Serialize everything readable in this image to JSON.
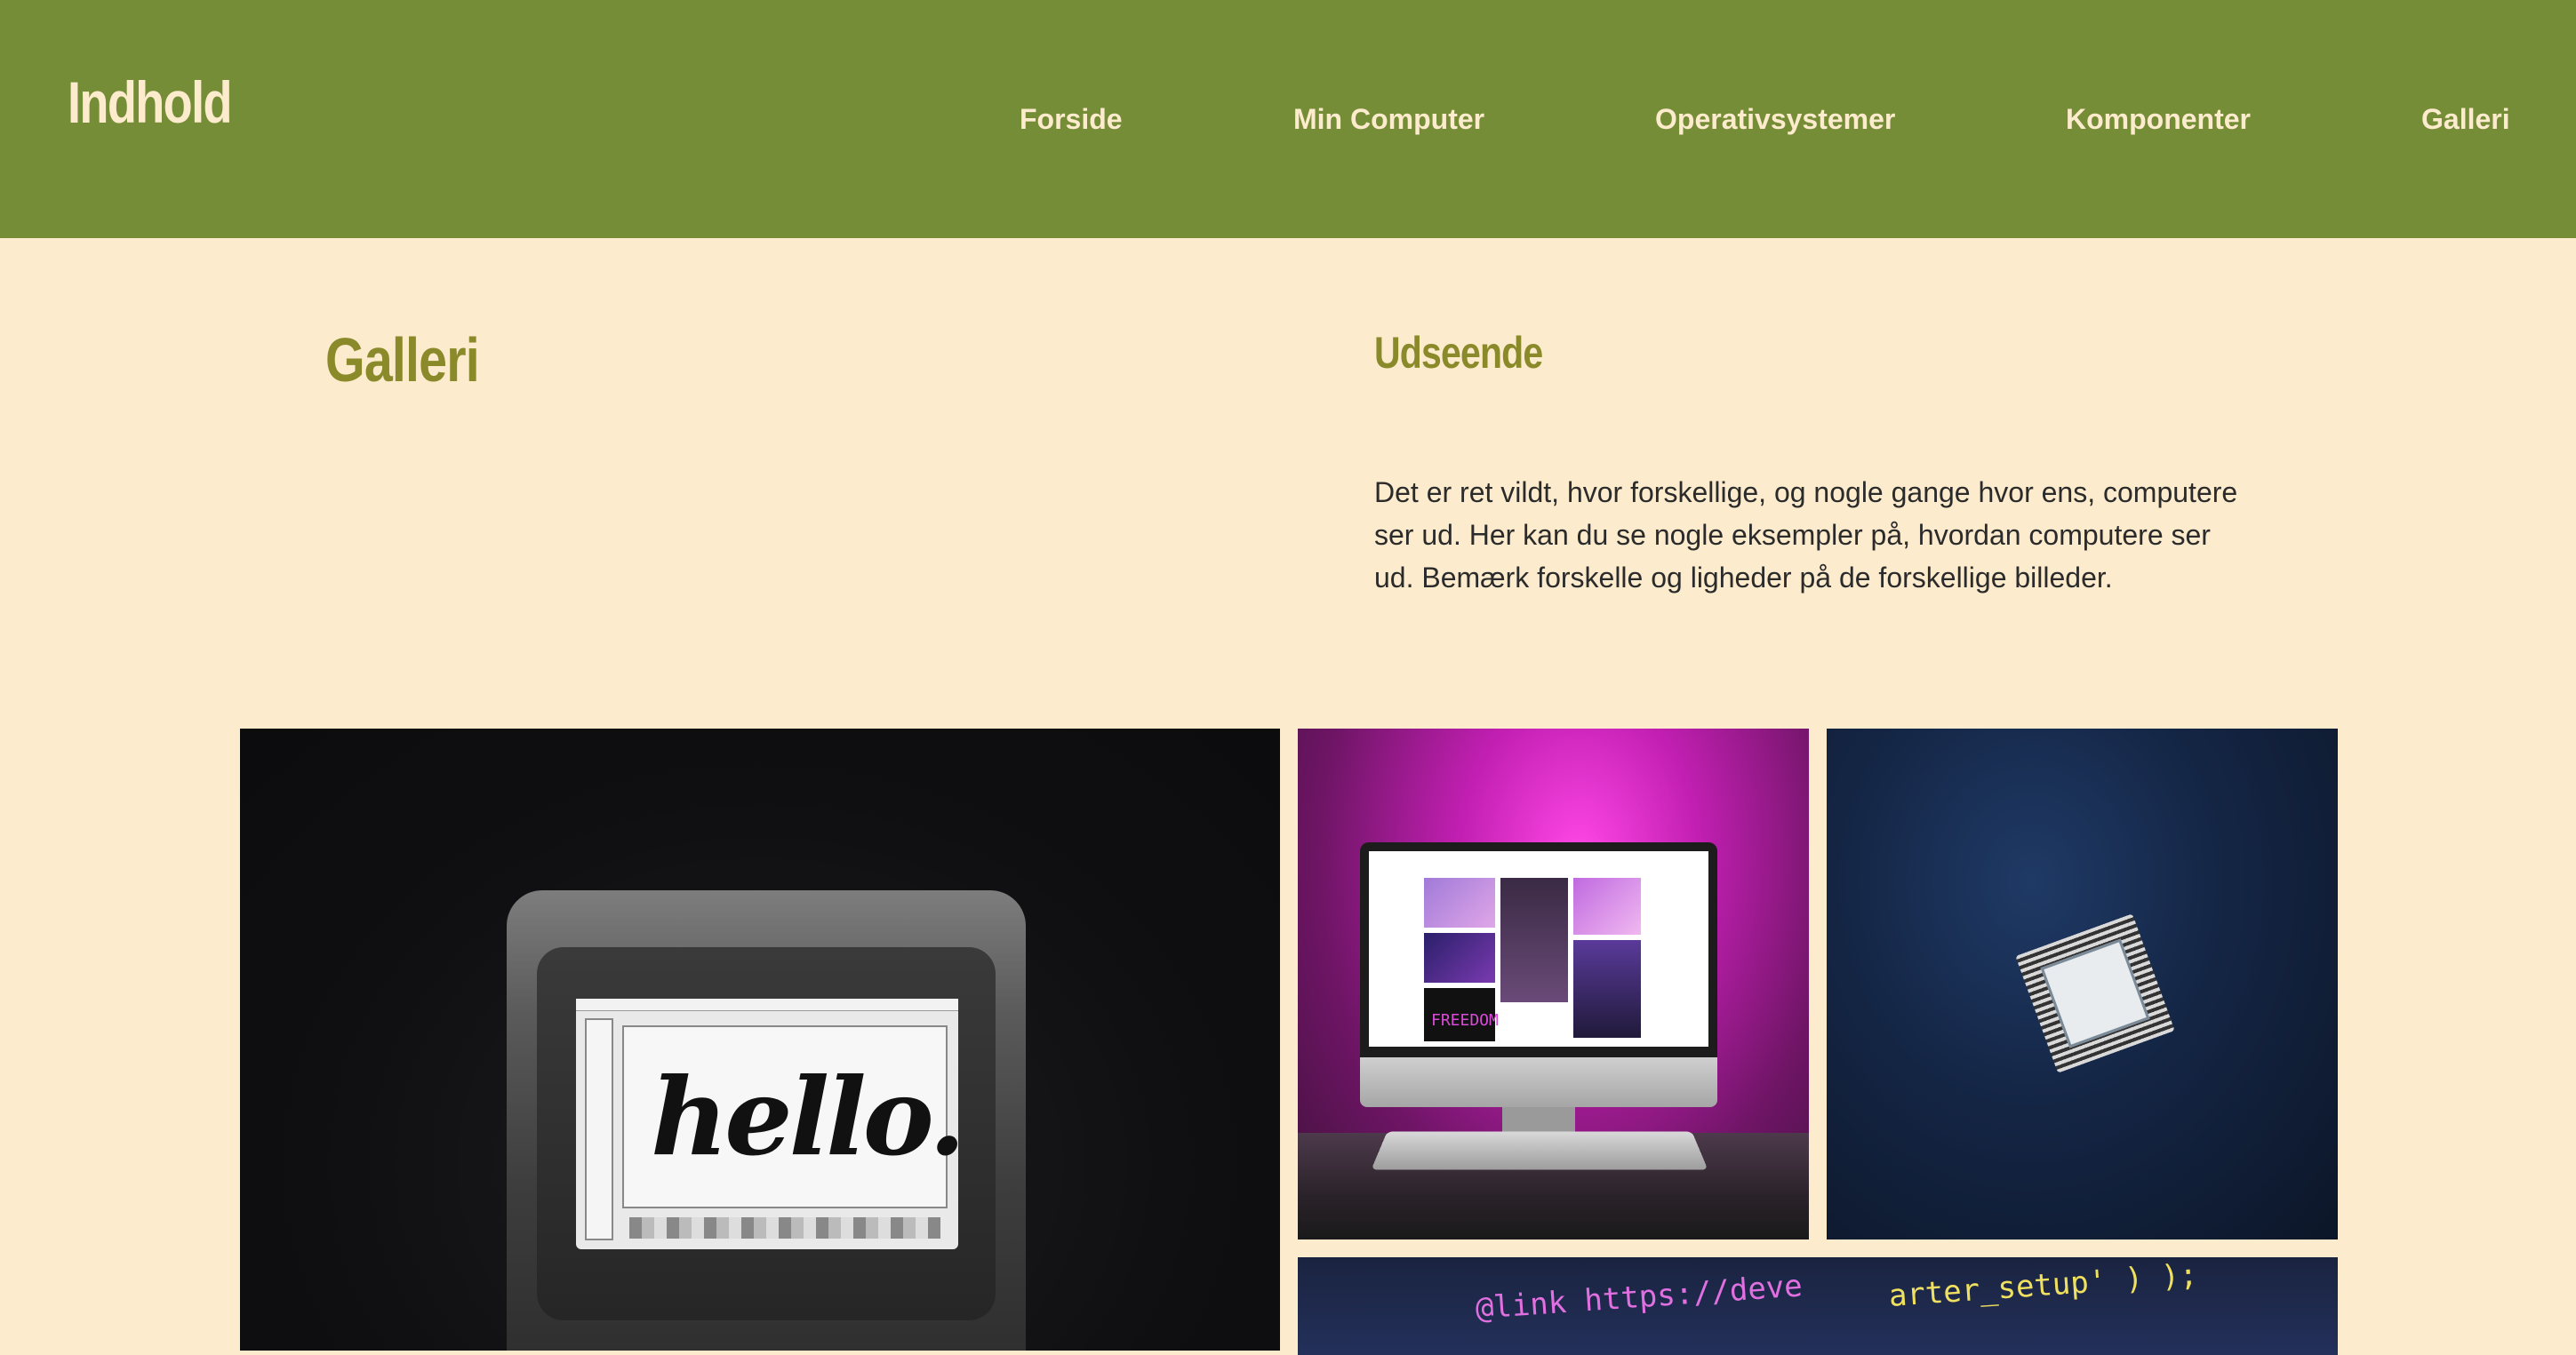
{
  "header": {
    "logo": "Indhold",
    "nav": [
      {
        "label": "Forside"
      },
      {
        "label": "Min Computer"
      },
      {
        "label": "Operativsystemer"
      },
      {
        "label": "Komponenter"
      },
      {
        "label": "Galleri"
      }
    ]
  },
  "main": {
    "page_title": "Galleri",
    "section_title": "Udseende",
    "intro_text": "Det er ret vildt, hvor forskellige, og nogle gange hvor ens, computere ser ud. Her kan du se nogle eksempler på, hvordan computere ser ud. Bemærk forskelle og ligheder på de forskellige billeder."
  },
  "gallery": {
    "retro": {
      "screen_text": "hello."
    },
    "imac": {
      "wallpaper_text": "FREEDOM"
    },
    "cpu": {},
    "code": {
      "line1": "@link https://deve",
      "line2": "arter_setup' ) );"
    }
  },
  "colors": {
    "header_bg": "#768d38",
    "page_bg": "#fcebcc",
    "accent_title": "#8a8a2a",
    "nav_text": "#fcebcc"
  }
}
